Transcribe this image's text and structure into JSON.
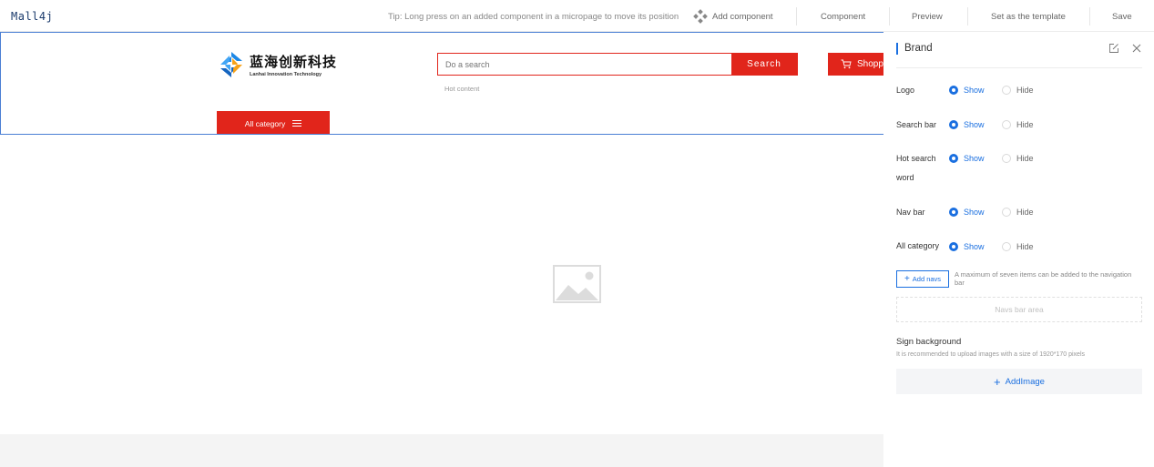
{
  "topbar": {
    "logo": "Mall4j",
    "tip": "Tip: Long press on an added component in a micropage to move its position",
    "add_component": "Add component",
    "component": "Component",
    "preview": "Preview",
    "set_template": "Set as the template",
    "save": "Save"
  },
  "header": {
    "brand_cn": "蓝海创新科技",
    "brand_en": "Lanhai Innovation Technology",
    "search_placeholder": "Do a search",
    "search_button": "Search",
    "hot_content": "Hot content",
    "cart_label": "Shopp",
    "all_category": "All category"
  },
  "panel": {
    "title": "Brand",
    "rows": [
      {
        "label": "Logo",
        "show": "Show",
        "hide": "Hide",
        "selected": "show"
      },
      {
        "label": "Search bar",
        "show": "Show",
        "hide": "Hide",
        "selected": "show"
      },
      {
        "label": "Hot search word",
        "show": "Show",
        "hide": "Hide",
        "selected": "show"
      },
      {
        "label": "Nav bar",
        "show": "Show",
        "hide": "Hide",
        "selected": "show"
      },
      {
        "label": "All category",
        "show": "Show",
        "hide": "Hide",
        "selected": "show"
      }
    ],
    "add_navs": "Add navs",
    "add_navs_tip": "A maximum of seven items can be added to the navigation bar",
    "navs_area": "Navs bar area",
    "sign_background": "Sign background",
    "sign_tip": "It is recommended to upload images with a size of 1920*170 pixels",
    "add_image": "AddImage"
  },
  "colors": {
    "accent_red": "#e1251b",
    "accent_blue": "#1a6fe0",
    "selection_border": "#4a7fd4"
  }
}
